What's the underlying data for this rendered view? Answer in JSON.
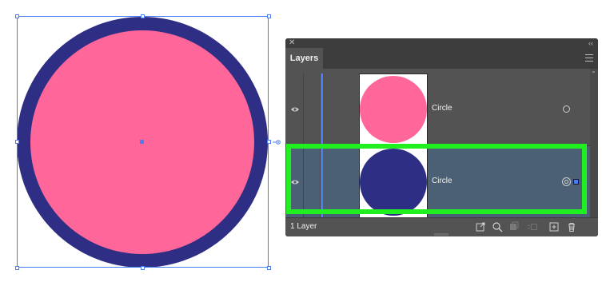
{
  "colors": {
    "fill": "#ff6699",
    "stroke": "#2e2e85",
    "selection": "#4a7cf7",
    "highlight": "#20f020"
  },
  "panel": {
    "tab_label": "Layers",
    "close_icon": "close-icon",
    "collapse_icon": "double-chevron-icon",
    "menu_icon": "menu-icon",
    "rows": [
      {
        "label": "Circle",
        "thumb_color": "#ff6699"
      },
      {
        "label": "Circle",
        "thumb_color": "#2e2e85"
      }
    ],
    "footer": {
      "layer_count": "1 Layer"
    }
  }
}
